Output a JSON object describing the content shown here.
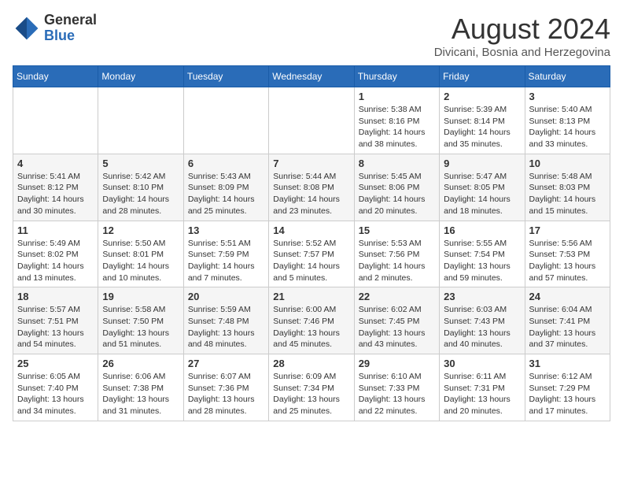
{
  "logo": {
    "general": "General",
    "blue": "Blue"
  },
  "title": {
    "month_year": "August 2024",
    "location": "Divicani, Bosnia and Herzegovina"
  },
  "days_of_week": [
    "Sunday",
    "Monday",
    "Tuesday",
    "Wednesday",
    "Thursday",
    "Friday",
    "Saturday"
  ],
  "weeks": [
    [
      {
        "day": "",
        "info": ""
      },
      {
        "day": "",
        "info": ""
      },
      {
        "day": "",
        "info": ""
      },
      {
        "day": "",
        "info": ""
      },
      {
        "day": "1",
        "info": "Sunrise: 5:38 AM\nSunset: 8:16 PM\nDaylight: 14 hours\nand 38 minutes."
      },
      {
        "day": "2",
        "info": "Sunrise: 5:39 AM\nSunset: 8:14 PM\nDaylight: 14 hours\nand 35 minutes."
      },
      {
        "day": "3",
        "info": "Sunrise: 5:40 AM\nSunset: 8:13 PM\nDaylight: 14 hours\nand 33 minutes."
      }
    ],
    [
      {
        "day": "4",
        "info": "Sunrise: 5:41 AM\nSunset: 8:12 PM\nDaylight: 14 hours\nand 30 minutes."
      },
      {
        "day": "5",
        "info": "Sunrise: 5:42 AM\nSunset: 8:10 PM\nDaylight: 14 hours\nand 28 minutes."
      },
      {
        "day": "6",
        "info": "Sunrise: 5:43 AM\nSunset: 8:09 PM\nDaylight: 14 hours\nand 25 minutes."
      },
      {
        "day": "7",
        "info": "Sunrise: 5:44 AM\nSunset: 8:08 PM\nDaylight: 14 hours\nand 23 minutes."
      },
      {
        "day": "8",
        "info": "Sunrise: 5:45 AM\nSunset: 8:06 PM\nDaylight: 14 hours\nand 20 minutes."
      },
      {
        "day": "9",
        "info": "Sunrise: 5:47 AM\nSunset: 8:05 PM\nDaylight: 14 hours\nand 18 minutes."
      },
      {
        "day": "10",
        "info": "Sunrise: 5:48 AM\nSunset: 8:03 PM\nDaylight: 14 hours\nand 15 minutes."
      }
    ],
    [
      {
        "day": "11",
        "info": "Sunrise: 5:49 AM\nSunset: 8:02 PM\nDaylight: 14 hours\nand 13 minutes."
      },
      {
        "day": "12",
        "info": "Sunrise: 5:50 AM\nSunset: 8:01 PM\nDaylight: 14 hours\nand 10 minutes."
      },
      {
        "day": "13",
        "info": "Sunrise: 5:51 AM\nSunset: 7:59 PM\nDaylight: 14 hours\nand 7 minutes."
      },
      {
        "day": "14",
        "info": "Sunrise: 5:52 AM\nSunset: 7:57 PM\nDaylight: 14 hours\nand 5 minutes."
      },
      {
        "day": "15",
        "info": "Sunrise: 5:53 AM\nSunset: 7:56 PM\nDaylight: 14 hours\nand 2 minutes."
      },
      {
        "day": "16",
        "info": "Sunrise: 5:55 AM\nSunset: 7:54 PM\nDaylight: 13 hours\nand 59 minutes."
      },
      {
        "day": "17",
        "info": "Sunrise: 5:56 AM\nSunset: 7:53 PM\nDaylight: 13 hours\nand 57 minutes."
      }
    ],
    [
      {
        "day": "18",
        "info": "Sunrise: 5:57 AM\nSunset: 7:51 PM\nDaylight: 13 hours\nand 54 minutes."
      },
      {
        "day": "19",
        "info": "Sunrise: 5:58 AM\nSunset: 7:50 PM\nDaylight: 13 hours\nand 51 minutes."
      },
      {
        "day": "20",
        "info": "Sunrise: 5:59 AM\nSunset: 7:48 PM\nDaylight: 13 hours\nand 48 minutes."
      },
      {
        "day": "21",
        "info": "Sunrise: 6:00 AM\nSunset: 7:46 PM\nDaylight: 13 hours\nand 45 minutes."
      },
      {
        "day": "22",
        "info": "Sunrise: 6:02 AM\nSunset: 7:45 PM\nDaylight: 13 hours\nand 43 minutes."
      },
      {
        "day": "23",
        "info": "Sunrise: 6:03 AM\nSunset: 7:43 PM\nDaylight: 13 hours\nand 40 minutes."
      },
      {
        "day": "24",
        "info": "Sunrise: 6:04 AM\nSunset: 7:41 PM\nDaylight: 13 hours\nand 37 minutes."
      }
    ],
    [
      {
        "day": "25",
        "info": "Sunrise: 6:05 AM\nSunset: 7:40 PM\nDaylight: 13 hours\nand 34 minutes."
      },
      {
        "day": "26",
        "info": "Sunrise: 6:06 AM\nSunset: 7:38 PM\nDaylight: 13 hours\nand 31 minutes."
      },
      {
        "day": "27",
        "info": "Sunrise: 6:07 AM\nSunset: 7:36 PM\nDaylight: 13 hours\nand 28 minutes."
      },
      {
        "day": "28",
        "info": "Sunrise: 6:09 AM\nSunset: 7:34 PM\nDaylight: 13 hours\nand 25 minutes."
      },
      {
        "day": "29",
        "info": "Sunrise: 6:10 AM\nSunset: 7:33 PM\nDaylight: 13 hours\nand 22 minutes."
      },
      {
        "day": "30",
        "info": "Sunrise: 6:11 AM\nSunset: 7:31 PM\nDaylight: 13 hours\nand 20 minutes."
      },
      {
        "day": "31",
        "info": "Sunrise: 6:12 AM\nSunset: 7:29 PM\nDaylight: 13 hours\nand 17 minutes."
      }
    ]
  ]
}
